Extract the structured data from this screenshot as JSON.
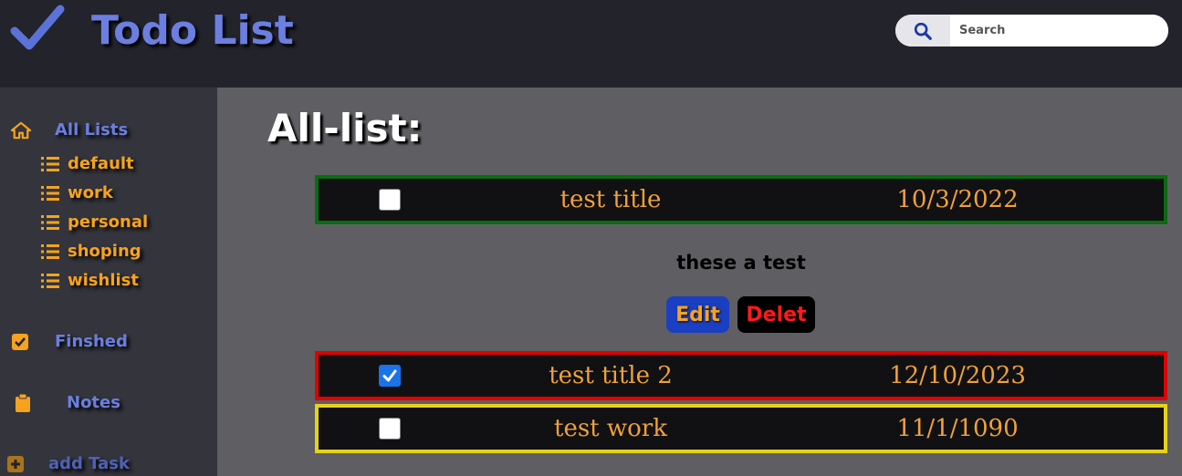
{
  "header": {
    "title": "Todo List",
    "logo_icon": "check-icon",
    "search": {
      "placeholder": "Search",
      "value": "",
      "icon": "search-icon"
    }
  },
  "sidebar": {
    "all_lists": {
      "label": "All Lists",
      "icon": "home-icon"
    },
    "lists": [
      {
        "label": "default",
        "icon": "list-icon"
      },
      {
        "label": "work",
        "icon": "list-icon"
      },
      {
        "label": "personal",
        "icon": "list-icon"
      },
      {
        "label": "shoping",
        "icon": "list-icon"
      },
      {
        "label": "wishlist",
        "icon": "list-icon"
      }
    ],
    "finished": {
      "label": "Finshed",
      "icon": "checkbox-icon"
    },
    "notes": {
      "label": "Notes",
      "icon": "clipboard-icon"
    },
    "add_task": {
      "label": "add Task",
      "icon": "plus-icon"
    }
  },
  "main": {
    "title": "All-list:",
    "tasks": [
      {
        "title": "test title",
        "date": "10/3/2022",
        "checked": false,
        "border_color": "#0b6b12",
        "description": "these a test"
      },
      {
        "title": "test title 2",
        "date": "12/10/2023",
        "checked": true,
        "border_color": "#e00000"
      },
      {
        "title": "test work",
        "date": "11/1/1090",
        "checked": false,
        "border_color": "#e6d21a"
      }
    ],
    "edit_label": "Edit",
    "delete_label": "Delet"
  },
  "colors": {
    "accent_blue": "#6b7fe0",
    "accent_orange": "#f7a21e",
    "header_bg": "#22232b",
    "sidebar_bg": "#34353c",
    "content_bg": "#5f5f63"
  }
}
